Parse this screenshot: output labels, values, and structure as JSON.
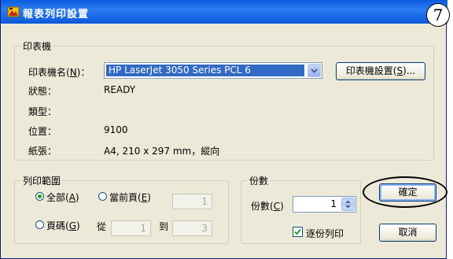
{
  "window": {
    "title": "報表列印設置",
    "step_number": "7"
  },
  "printer_group": {
    "legend": "印表機",
    "name_label": "印表機名(",
    "name_key": "N",
    "name_label_end": ")：",
    "selected_printer": "HP LaserJet 3050 Series PCL 6",
    "settings_button": "印表機設置(",
    "settings_key": "S",
    "settings_end": ")...",
    "status_label": "狀態：",
    "status_value": "READY",
    "type_label": "類型：",
    "type_value": "",
    "location_label": "位置：",
    "location_value": "9100",
    "paper_label": "紙張：",
    "paper_value": "A4, 210 x 297 mm，縱向"
  },
  "range_group": {
    "legend": "列印範圍",
    "all_label": "全部(",
    "all_key": "A",
    "current_label": "當前頁(",
    "current_key": "E",
    "current_value": "1",
    "pages_label": "頁碼(",
    "pages_key": "G",
    "from_label": "從",
    "from_value": "1",
    "to_label": "到",
    "to_value": "3",
    "close_paren": ")"
  },
  "copies_group": {
    "legend": "份數",
    "copies_label": "份數(",
    "copies_key": "C",
    "copies_end": ")",
    "copies_value": "1",
    "collate_label": "逐份列印",
    "collate_checked": true
  },
  "buttons": {
    "ok": "確定",
    "cancel": "取消"
  },
  "colors": {
    "title_bar": "#0a5ce0",
    "dialog_bg": "#ece9d8",
    "selection": "#316ac5"
  }
}
